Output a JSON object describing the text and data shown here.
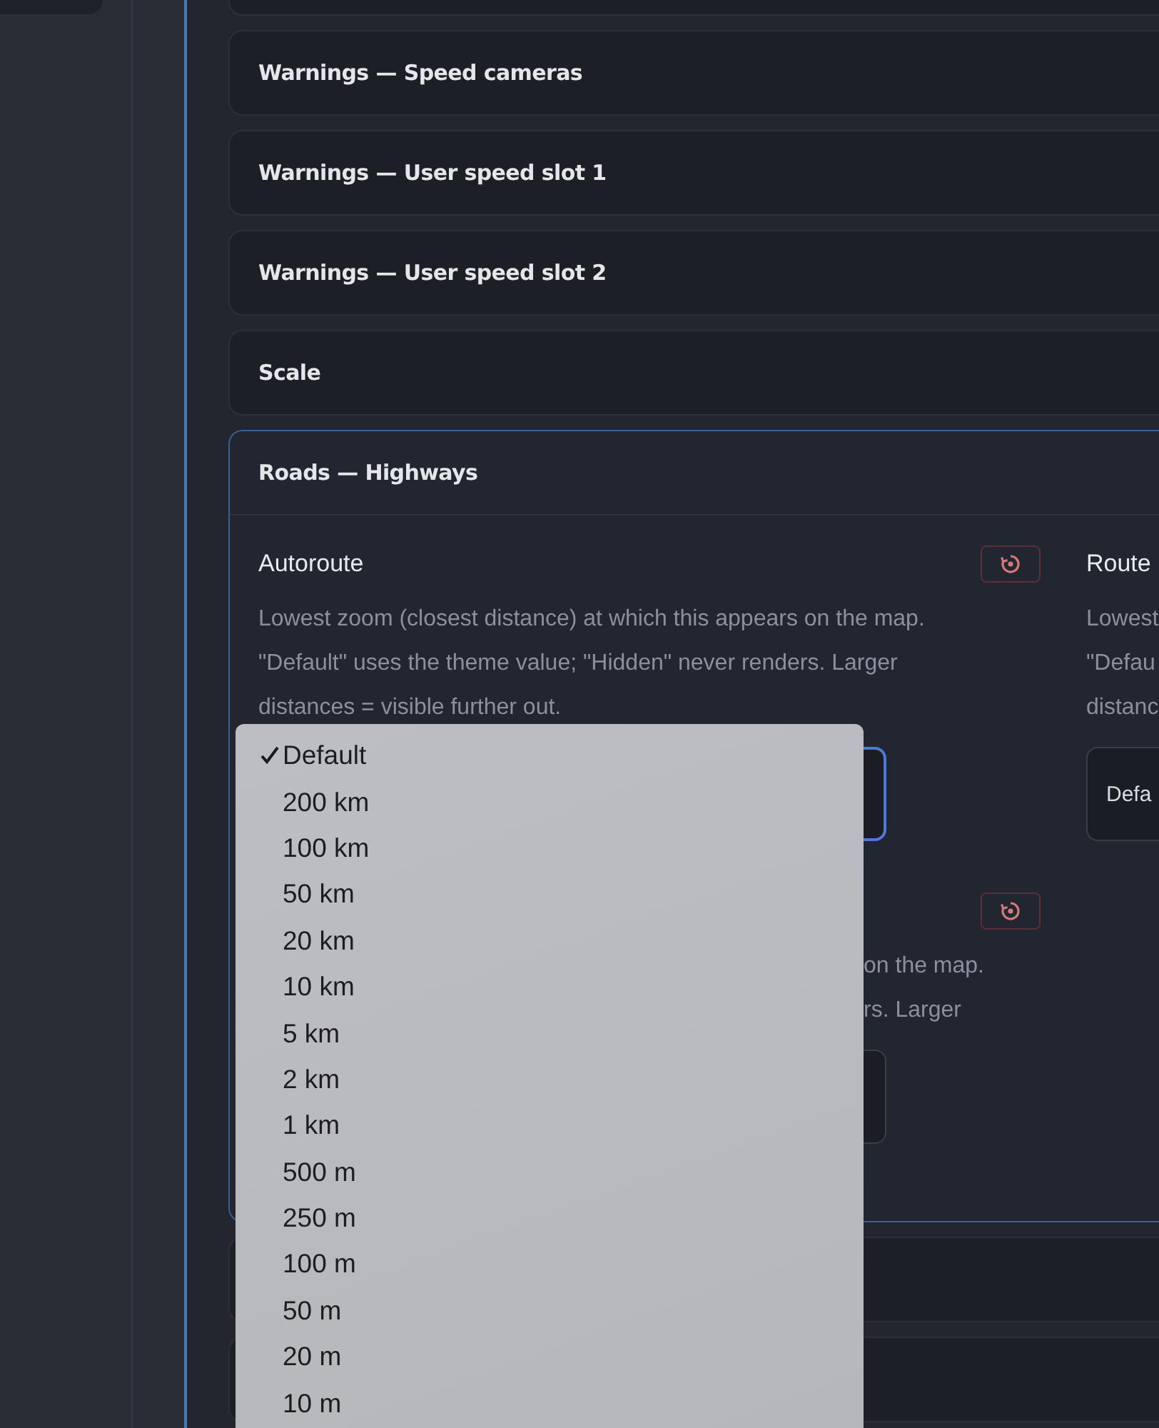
{
  "sections": [
    {
      "title": "Warnings — Speed cameras",
      "expanded": false
    },
    {
      "title": "Warnings — User speed slot 1",
      "expanded": false
    },
    {
      "title": "Warnings — User speed slot 2",
      "expanded": false
    },
    {
      "title": "Scale",
      "expanded": false
    },
    {
      "title": "Roads — Highways",
      "expanded": true,
      "columns": [
        [
          {
            "label": "Autoroute",
            "description": "Lowest zoom (closest distance) at which this appears on the map. \"Default\" uses the theme value; \"Hidden\" never renders. Larger distances = visible further out.",
            "focused": true
          },
          {
            "description_lines": [
              "on the map.",
              "rs. Larger"
            ],
            "focused": false
          }
        ],
        [
          {
            "label": "Route",
            "description_lines": [
              "Lowest",
              "\"Defau",
              "distanc"
            ],
            "value": "Defa",
            "focused": false
          }
        ]
      ]
    },
    {
      "expanded": false
    },
    {
      "expanded": false
    }
  ],
  "dropdown": {
    "options": [
      {
        "label": "Default",
        "selected": true
      },
      {
        "label": "200 km",
        "selected": false
      },
      {
        "label": "100 km",
        "selected": false
      },
      {
        "label": "50 km",
        "selected": false
      },
      {
        "label": "20 km",
        "selected": false
      },
      {
        "label": "10 km",
        "selected": false
      },
      {
        "label": "5 km",
        "selected": false
      },
      {
        "label": "2 km",
        "selected": false
      },
      {
        "label": "1 km",
        "selected": false
      },
      {
        "label": "500 m",
        "selected": false
      },
      {
        "label": "250 m",
        "selected": false
      },
      {
        "label": "100 m",
        "selected": false
      },
      {
        "label": "50 m",
        "selected": false
      },
      {
        "label": "20 m",
        "selected": false
      },
      {
        "label": "10 m",
        "selected": false
      }
    ]
  }
}
